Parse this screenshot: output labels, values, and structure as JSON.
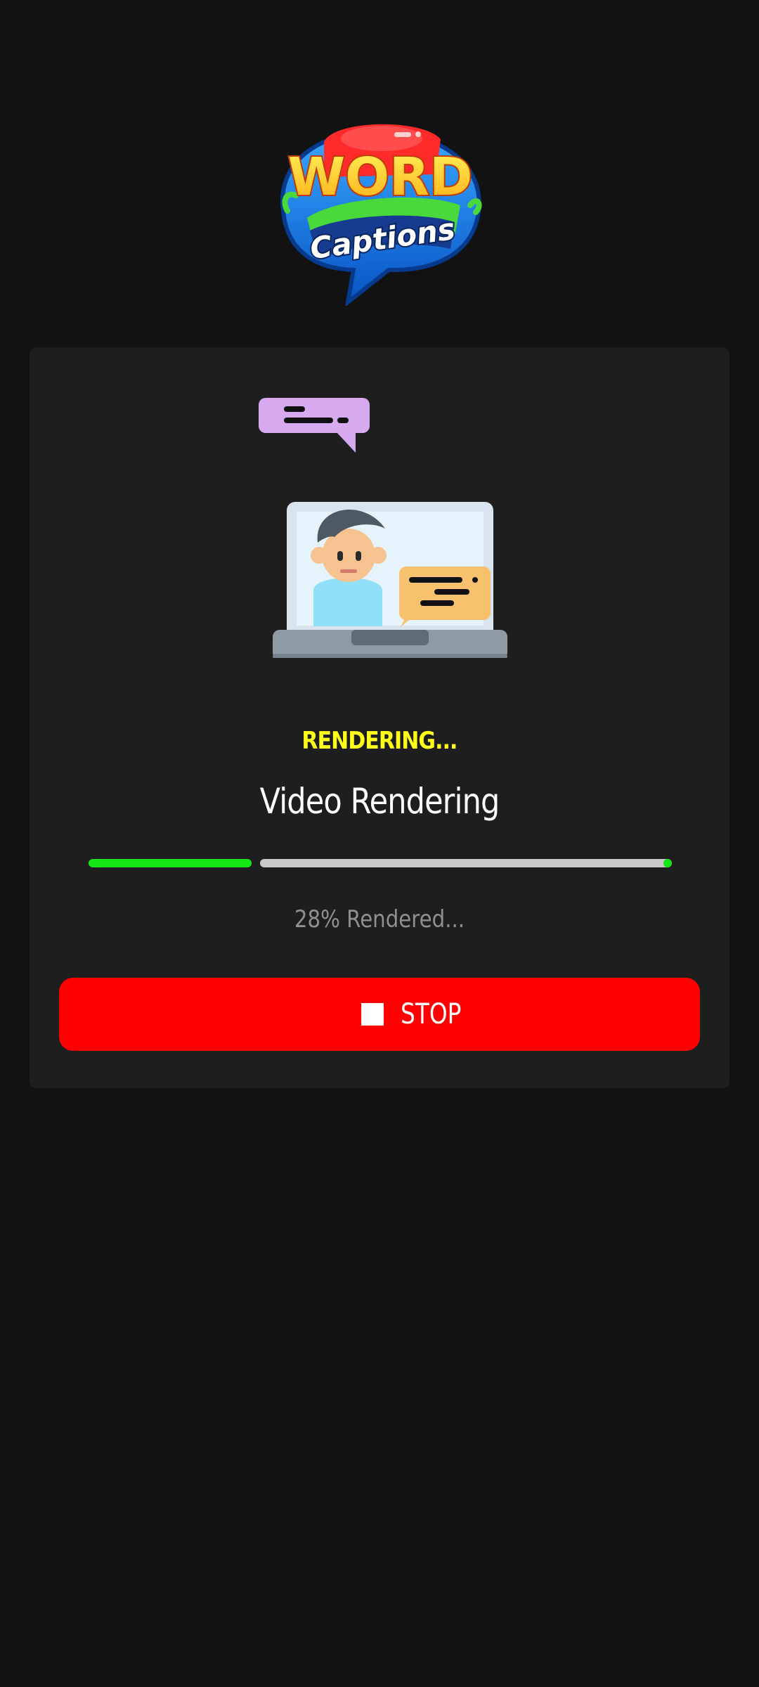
{
  "app": {
    "logo": {
      "line1": "WORD",
      "line2": "Captions"
    }
  },
  "render": {
    "status": "RENDERING...",
    "title": "Video Rendering",
    "progress_percent": 28,
    "progress_text": "28% Rendered..."
  },
  "actions": {
    "stop_label": "STOP"
  },
  "colors": {
    "background": "#121212",
    "card": "#1e1e1e",
    "status": "#ffff1a",
    "progress_fill": "#16e616",
    "progress_track": "#c8c8c8",
    "stop_button": "#ff0000"
  },
  "icons": {
    "illustration": "video-call-laptop-illustration",
    "stop": "stop-icon"
  }
}
